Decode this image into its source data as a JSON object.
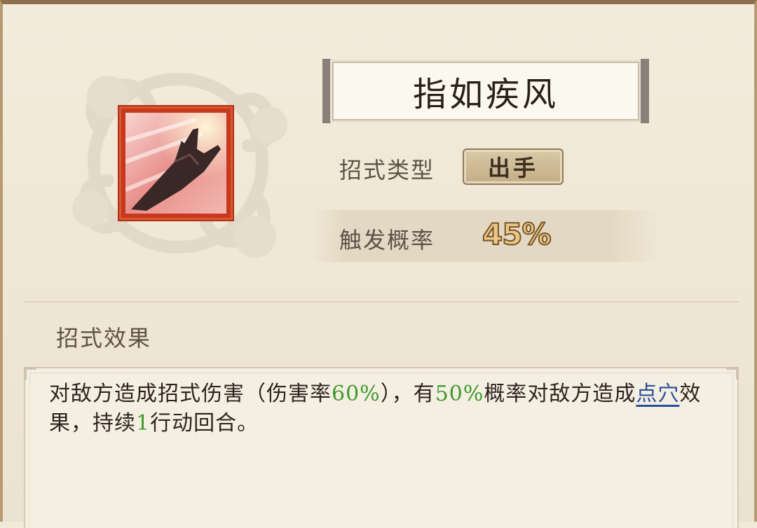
{
  "skill": {
    "name": "指如疾风",
    "type_label": "招式类型",
    "type_value": "出手",
    "rate_label": "触发概率",
    "rate_value": "45%"
  },
  "effect": {
    "section_label": "招式效果",
    "parts": {
      "p1": "对敌方造成招式伤害（伤害率",
      "v1": "60%",
      "p2": "），有",
      "v2": "50%",
      "p3": "概率对敌方造成",
      "link": "点穴",
      "p4": "效果，持续",
      "v3": "1",
      "p5": "行动回合。"
    }
  },
  "colors": {
    "highlight_green": "#3f9a2a",
    "link_blue": "#2a4f9a",
    "rate_gold": "#e9c889",
    "icon_red": "#c7381f"
  },
  "icons": {
    "skill_icon": "hand-strike-icon",
    "emblem": "cloud-swirl-emblem"
  }
}
